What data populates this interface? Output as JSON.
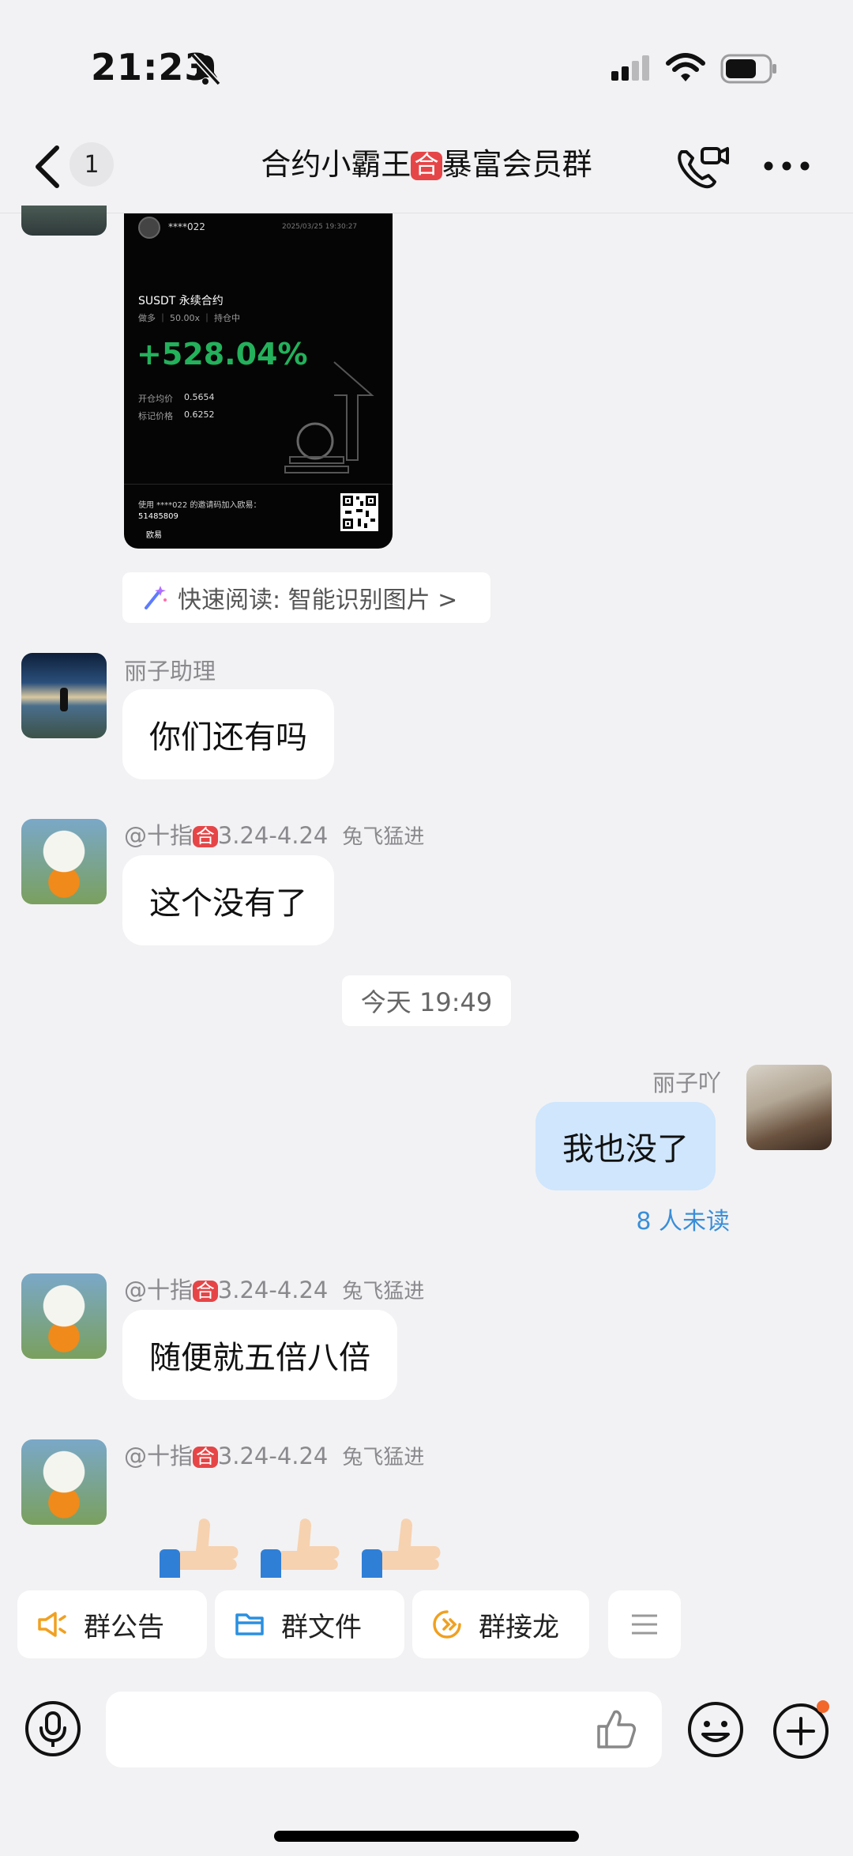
{
  "status_bar": {
    "time": "21:23"
  },
  "header": {
    "unread_count": "1",
    "title_prefix": "合约小霸王",
    "title_badge": "合",
    "title_suffix": "暴富会员群"
  },
  "messages": {
    "share_card": {
      "user": "****022",
      "datetime": "2025/03/25 19:30:27",
      "contract": "SUSDT 永续合约",
      "meta": "做多 ｜ 50.00x ｜ 持仓中",
      "profit": "+528.04%",
      "open_label": "开仓均价",
      "open_value": "0.5654",
      "mark_label": "标记价格",
      "mark_value": "0.6252",
      "invite_text": "使用 ****022 的邀请码加入欧易：",
      "invite_code": "51485809",
      "brand": "欧易"
    },
    "quick_read": "快速阅读: 智能识别图片 >",
    "msg1": {
      "sender": "丽子助理",
      "text": "你们还有吗"
    },
    "msg2": {
      "sender_prefix": "@十指",
      "sender_badge": "合",
      "sender_suffix": "3.24-4.24",
      "tag": "兔飞猛进",
      "text": "这个没有了"
    },
    "time_separator": "今天 19:49",
    "msg3": {
      "sender": "丽子吖",
      "text": "我也没了",
      "read_status": "8 人未读"
    },
    "msg4": {
      "sender_prefix": "@十指",
      "sender_badge": "合",
      "sender_suffix": "3.24-4.24",
      "tag": "兔飞猛进",
      "text": "随便就五倍八倍"
    },
    "msg5": {
      "sender_prefix": "@十指",
      "sender_badge": "合",
      "sender_suffix": "3.24-4.24",
      "tag": "兔飞猛进",
      "emojis": [
        "thumbs-up",
        "thumbs-up",
        "thumbs-up"
      ]
    }
  },
  "quick_actions": [
    {
      "label": "群公告",
      "icon": "megaphone-icon"
    },
    {
      "label": "群文件",
      "icon": "folder-icon"
    },
    {
      "label": "群接龙",
      "icon": "relay-icon"
    }
  ],
  "input": {
    "placeholder": ""
  },
  "colors": {
    "accent": "#3a8ed8",
    "badge_red": "#e64547",
    "my_bubble": "#cfe6fd",
    "profit_green": "#23b15b"
  }
}
